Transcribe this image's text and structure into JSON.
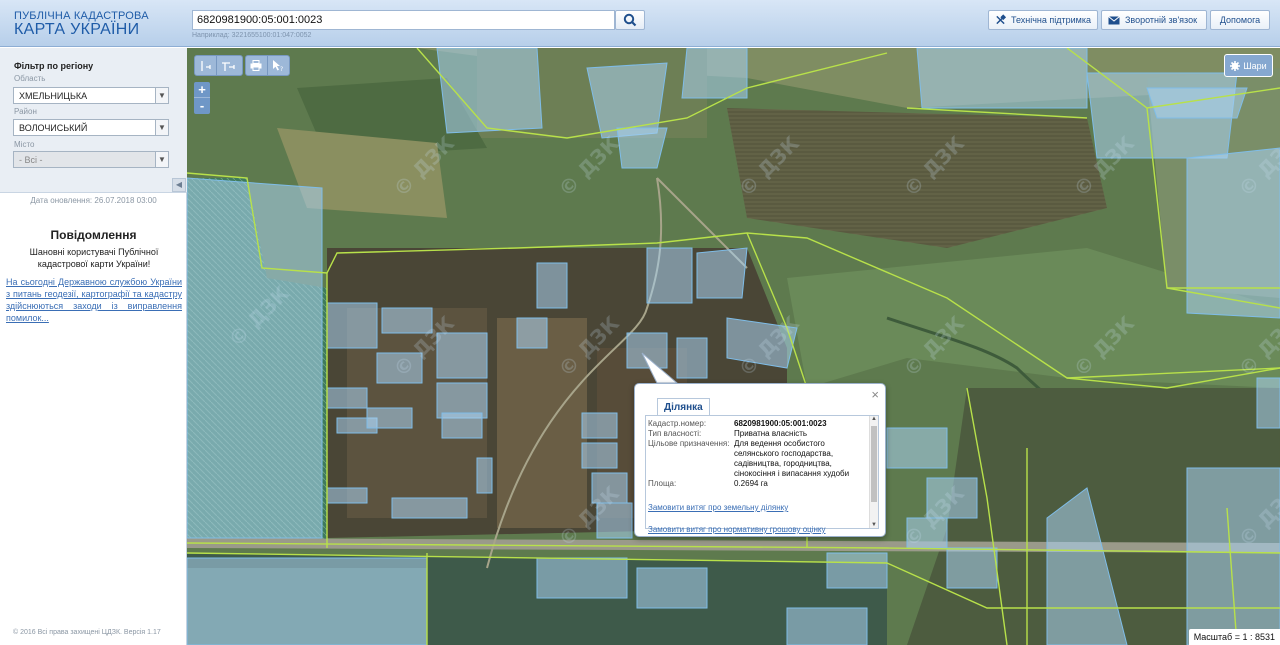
{
  "header": {
    "logo_line1": "ПУБЛІЧНА КАДАСТРОВА",
    "logo_line2": "КАРТА УКРАЇНИ",
    "search_value": "6820981900:05:001:0023",
    "search_hint": "Наприклад: 3221655100:01:047:0052",
    "buttons": {
      "tech_support": "Технічна підтримка",
      "feedback": "Зворотній зв'язок",
      "help": "Допомога"
    }
  },
  "filter": {
    "title": "Фільтр по регіону",
    "oblast_label": "Область",
    "oblast_value": "ХМЕЛЬНИЦЬКА",
    "rayon_label": "Район",
    "rayon_value": "ВОЛОЧИСЬКИЙ",
    "city_label": "Місто",
    "city_value": "- Всі -"
  },
  "update_date": "Дата оновлення: 26.07.2018 03:00",
  "notice": {
    "title": "Повідомлення",
    "text": "Шановні користувачі Публічної кадастрової карти України!",
    "link": "На сьогодні Державною службою України з питань геодезії, картографії та кадастру здійснюються заходи із виправлення помилок..."
  },
  "copyright": "© 2016 Всі права захищені ЦДЗК. Версія 1.17",
  "map": {
    "layers_label": "Шари",
    "scale_text": "Масштаб = 1 : 8531",
    "watermark": "© ДЗК",
    "tools": [
      "ruler-line-icon",
      "ruler-area-icon",
      "print-icon",
      "info-cursor-icon"
    ]
  },
  "popup": {
    "tab_label": "Ділянка",
    "rows": [
      {
        "key": "Кадастр.номер:",
        "value": "6820981900:05:001:0023"
      },
      {
        "key": "Тип власності:",
        "value": "Приватна власність"
      },
      {
        "key": "Цільове призначення:",
        "value": "Для ведення особистого селянського господарства, садівництва, городництва, сінокосіння і випасання худоби"
      },
      {
        "key": "Площа:",
        "value": "0.2694 га"
      }
    ],
    "link1": "Замовити витяг про земельну ділянку",
    "link2": "Замовити витяг про нормативну грошову оцінку"
  }
}
